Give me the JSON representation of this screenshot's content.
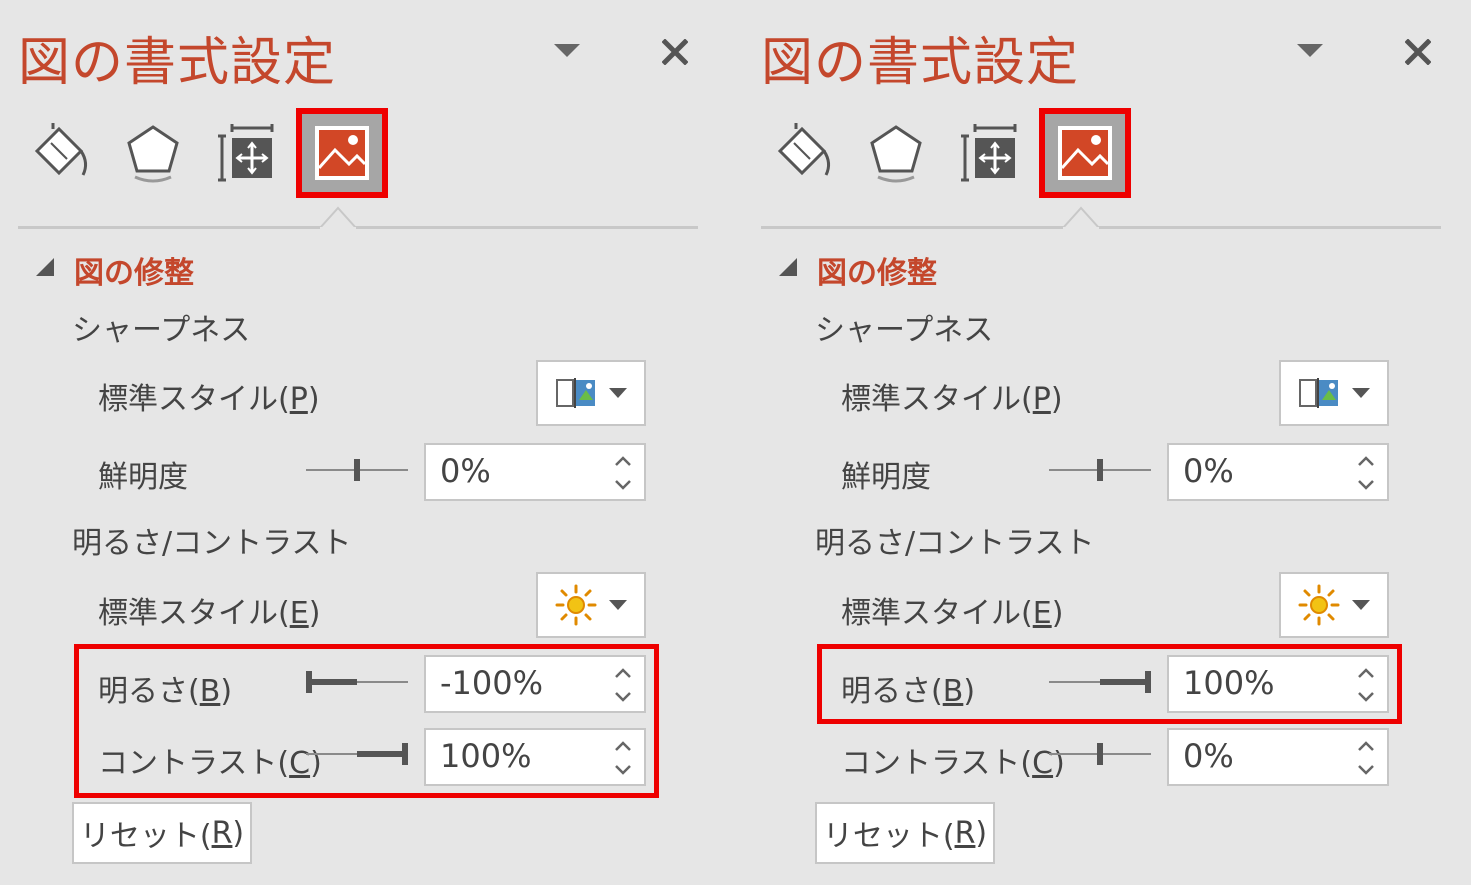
{
  "panels": [
    {
      "title": "図の書式設定",
      "section_title": "図の修整",
      "sharpness_heading": "シャープネス",
      "sharpness_preset_label": "標準スタイル(",
      "sharpness_preset_key": "P",
      "sharpness_label": "鮮明度",
      "sharpness_value": "0%",
      "sharpness_level": 0,
      "bc_heading": "明るさ/コントラスト",
      "bc_preset_label": "標準スタイル(",
      "bc_preset_key": "E",
      "brightness_label": "明るさ(",
      "brightness_key": "B",
      "brightness_value": "-100%",
      "brightness_level": -100,
      "contrast_label": "コントラスト(",
      "contrast_key": "C",
      "contrast_value": "100%",
      "contrast_level": 100,
      "reset_label": "リセット(",
      "reset_key": "R",
      "close_symbol": "×"
    },
    {
      "title": "図の書式設定",
      "section_title": "図の修整",
      "sharpness_heading": "シャープネス",
      "sharpness_preset_label": "標準スタイル(",
      "sharpness_preset_key": "P",
      "sharpness_label": "鮮明度",
      "sharpness_value": "0%",
      "sharpness_level": 0,
      "bc_heading": "明るさ/コントラスト",
      "bc_preset_label": "標準スタイル(",
      "bc_preset_key": "E",
      "brightness_label": "明るさ(",
      "brightness_key": "B",
      "brightness_value": "100%",
      "brightness_level": 100,
      "contrast_label": "コントラスト(",
      "contrast_key": "C",
      "contrast_value": "0%",
      "contrast_level": 0,
      "reset_label": "リセット(",
      "reset_key": "R",
      "close_symbol": "×"
    }
  ],
  "colors": {
    "accent": "#c4472c",
    "highlight": "#ee0000",
    "panel_bg": "#e6e6e6",
    "active_tab_bg": "#a6a6a6",
    "text": "#444444"
  },
  "icons": [
    "fill-line-icon",
    "effects-pentagon-icon",
    "size-position-icon",
    "picture-icon",
    "chevron-down-icon",
    "close-icon",
    "collapse-triangle-icon",
    "sharpness-preset-icon",
    "brightness-sun-icon"
  ]
}
